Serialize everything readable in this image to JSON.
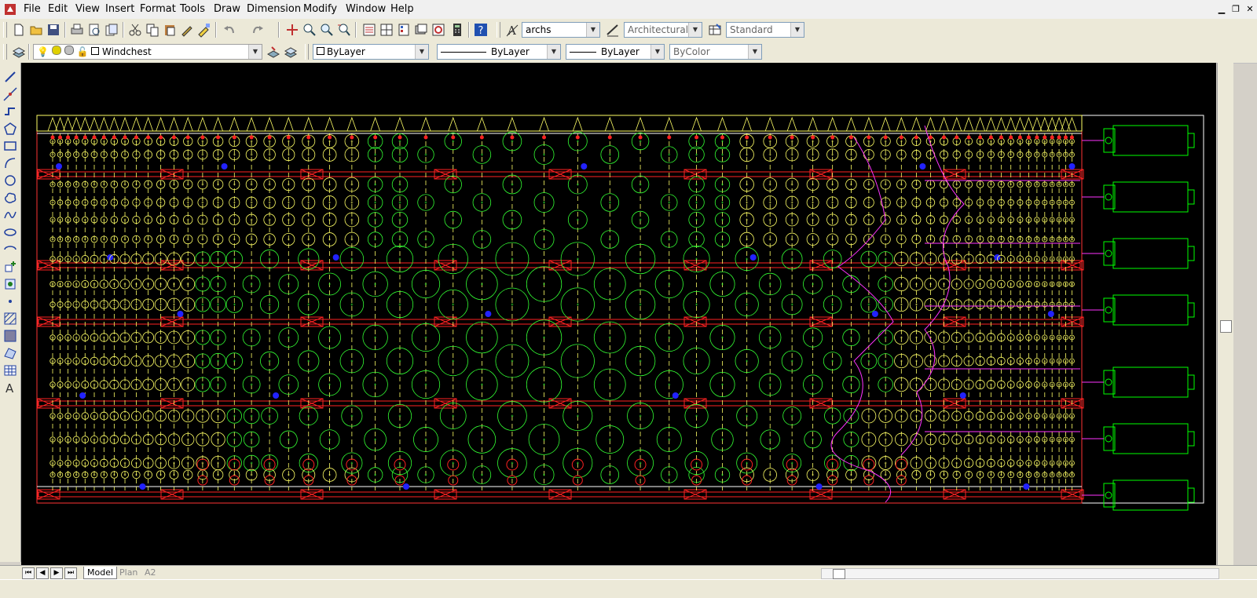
{
  "menu": {
    "items": [
      "File",
      "Edit",
      "View",
      "Insert",
      "Format",
      "Tools",
      "Draw",
      "Dimension",
      "Modify",
      "Window",
      "Help"
    ]
  },
  "toolbar": {
    "text_style": "archs",
    "dim_style": "Architectural",
    "table_style": "Standard"
  },
  "layers": {
    "current_layer": "Windchest",
    "color": "ByLayer",
    "linetype": "ByLayer",
    "lineweight": "ByLayer",
    "plot_style": "ByColor"
  },
  "tabs": [
    {
      "label": "Model",
      "active": true
    },
    {
      "label": "Plan",
      "active": false
    },
    {
      "label": "A2",
      "active": false
    }
  ],
  "colors": {
    "canvas": "#000000",
    "pipes_large": "#33ff33",
    "pipes_small": "#ffff66",
    "pallets": "#ff2222",
    "magnets": "#2222ff",
    "motors": "#00ff00",
    "wind_line": "#ff33ff",
    "text": "#00ffff",
    "frame": "#ffffff"
  },
  "icons": {
    "new": "new-file-icon",
    "open": "open-icon",
    "save": "save-icon",
    "print": "print-icon",
    "cut": "cut-icon",
    "copy": "copy-icon",
    "paste": "paste-icon",
    "match": "match-properties-icon",
    "undo": "undo-icon",
    "redo": "redo-icon",
    "pan": "pan-icon",
    "zoom": "zoom-icon",
    "properties": "properties-icon",
    "calculator": "calculator-icon",
    "help": "help-icon"
  }
}
